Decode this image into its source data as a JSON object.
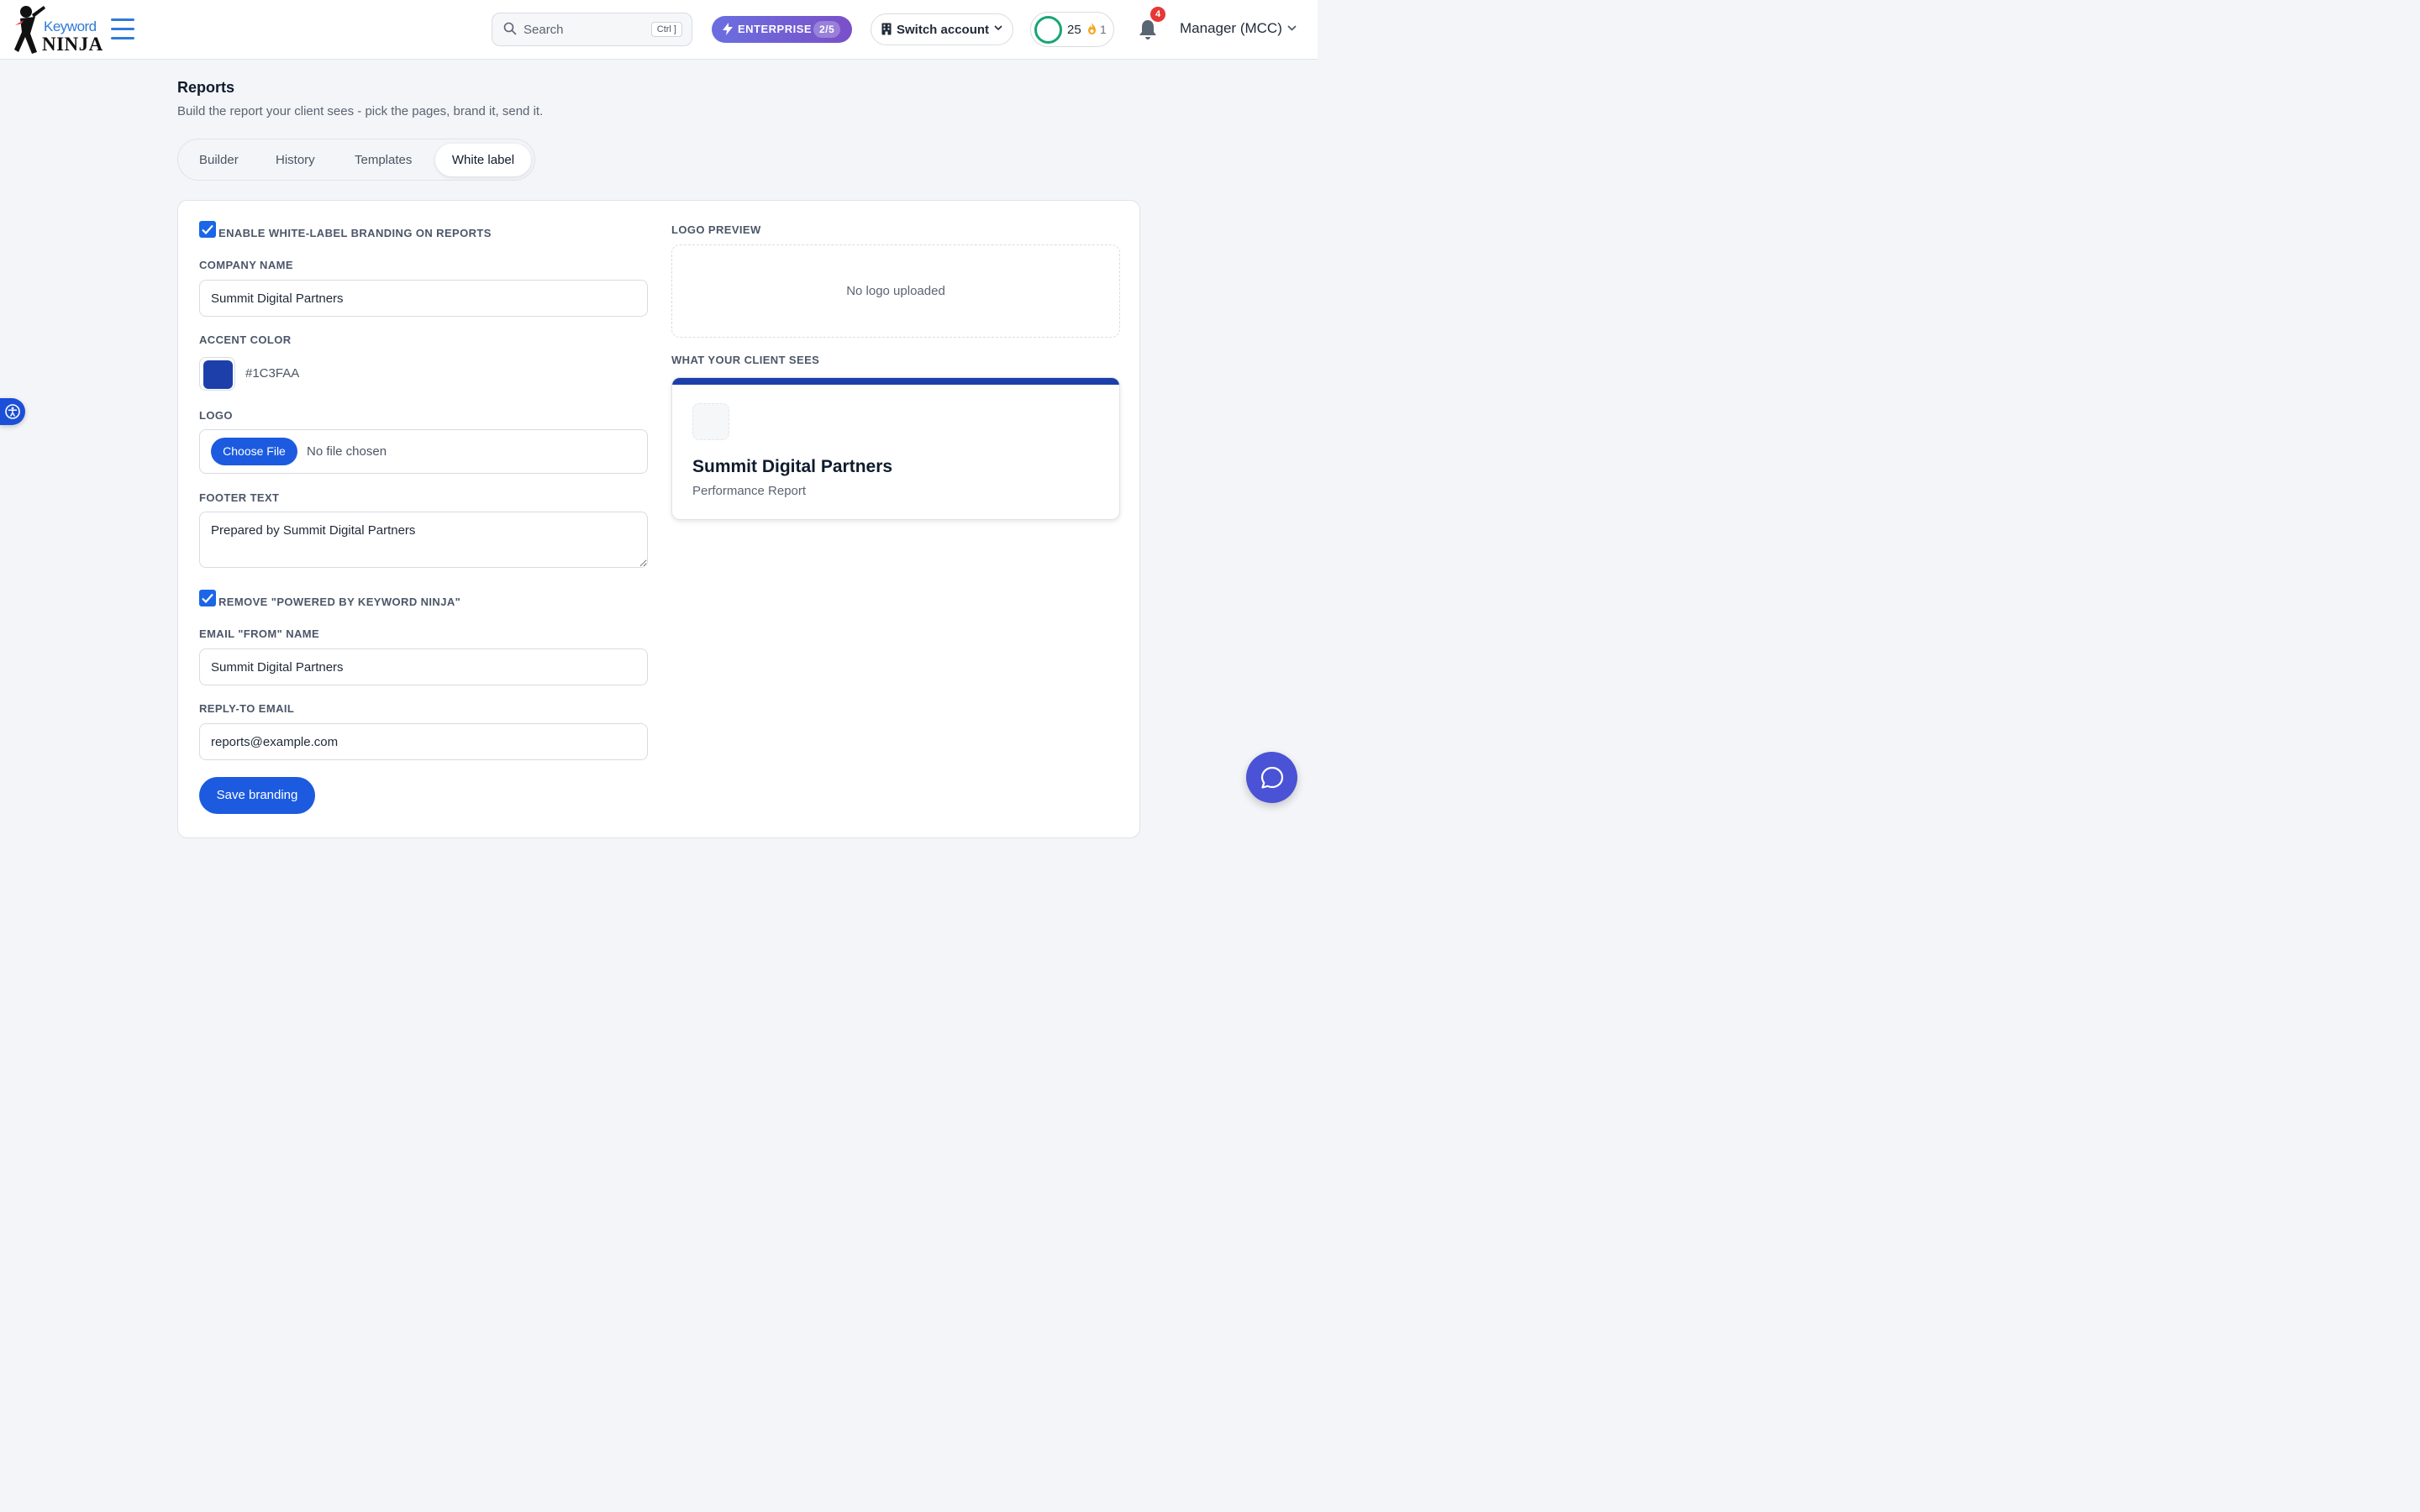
{
  "header": {
    "logo_word": "Keyword",
    "logo_mark": "NINJA",
    "search_placeholder": "Search",
    "search_shortcut": "Ctrl ]",
    "plan_label": "ENTERPRISE",
    "plan_count": "2/5",
    "switch_account_label": "Switch account",
    "credits": "25",
    "streak": "1",
    "notification_count": "4",
    "account_label": "Manager (MCC)"
  },
  "page": {
    "title": "Reports",
    "subtitle": "Build the report your client sees - pick the pages, brand it, send it."
  },
  "tabs": [
    {
      "label": "Builder"
    },
    {
      "label": "History"
    },
    {
      "label": "Templates"
    },
    {
      "label": "White label",
      "active": true
    }
  ],
  "form": {
    "enable_label": "Enable white-label branding on reports",
    "enable_checked": true,
    "company_name_label": "Company name",
    "company_name_value": "Summit Digital Partners",
    "accent_color_label": "Accent color",
    "accent_color_value": "#1C3FAA",
    "logo_label": "Logo",
    "choose_file_label": "Choose File",
    "no_file_label": "No file chosen",
    "footer_text_label": "Footer text",
    "footer_text_value": "Prepared by Summit Digital Partners",
    "remove_powered_label": "Remove \"Powered by Keyword Ninja\"",
    "remove_powered_checked": true,
    "email_from_label": "Email \"From\" name",
    "email_from_value": "Summit Digital Partners",
    "reply_to_label": "Reply-to email",
    "reply_to_value": "reports@example.com",
    "save_label": "Save branding"
  },
  "preview": {
    "logo_preview_label": "Logo preview",
    "no_logo_label": "No logo uploaded",
    "client_sees_label": "What your client sees",
    "client_company": "Summit Digital Partners",
    "client_report_title": "Performance Report"
  },
  "colors": {
    "accent": "#1C3FAA",
    "primary_button": "#1C5BE0",
    "enterprise_gradient": "#6A6FE0",
    "credit_ring": "#17A673",
    "notification_badge": "#E53935"
  },
  "icons": {
    "menu": "hamburger-icon",
    "search": "search-icon",
    "plan": "lightning-icon",
    "switch_account": "building-icon",
    "streak": "flame-icon",
    "notifications": "bell-icon",
    "accessibility": "accessibility-icon",
    "chat": "chat-bubble-icon"
  }
}
